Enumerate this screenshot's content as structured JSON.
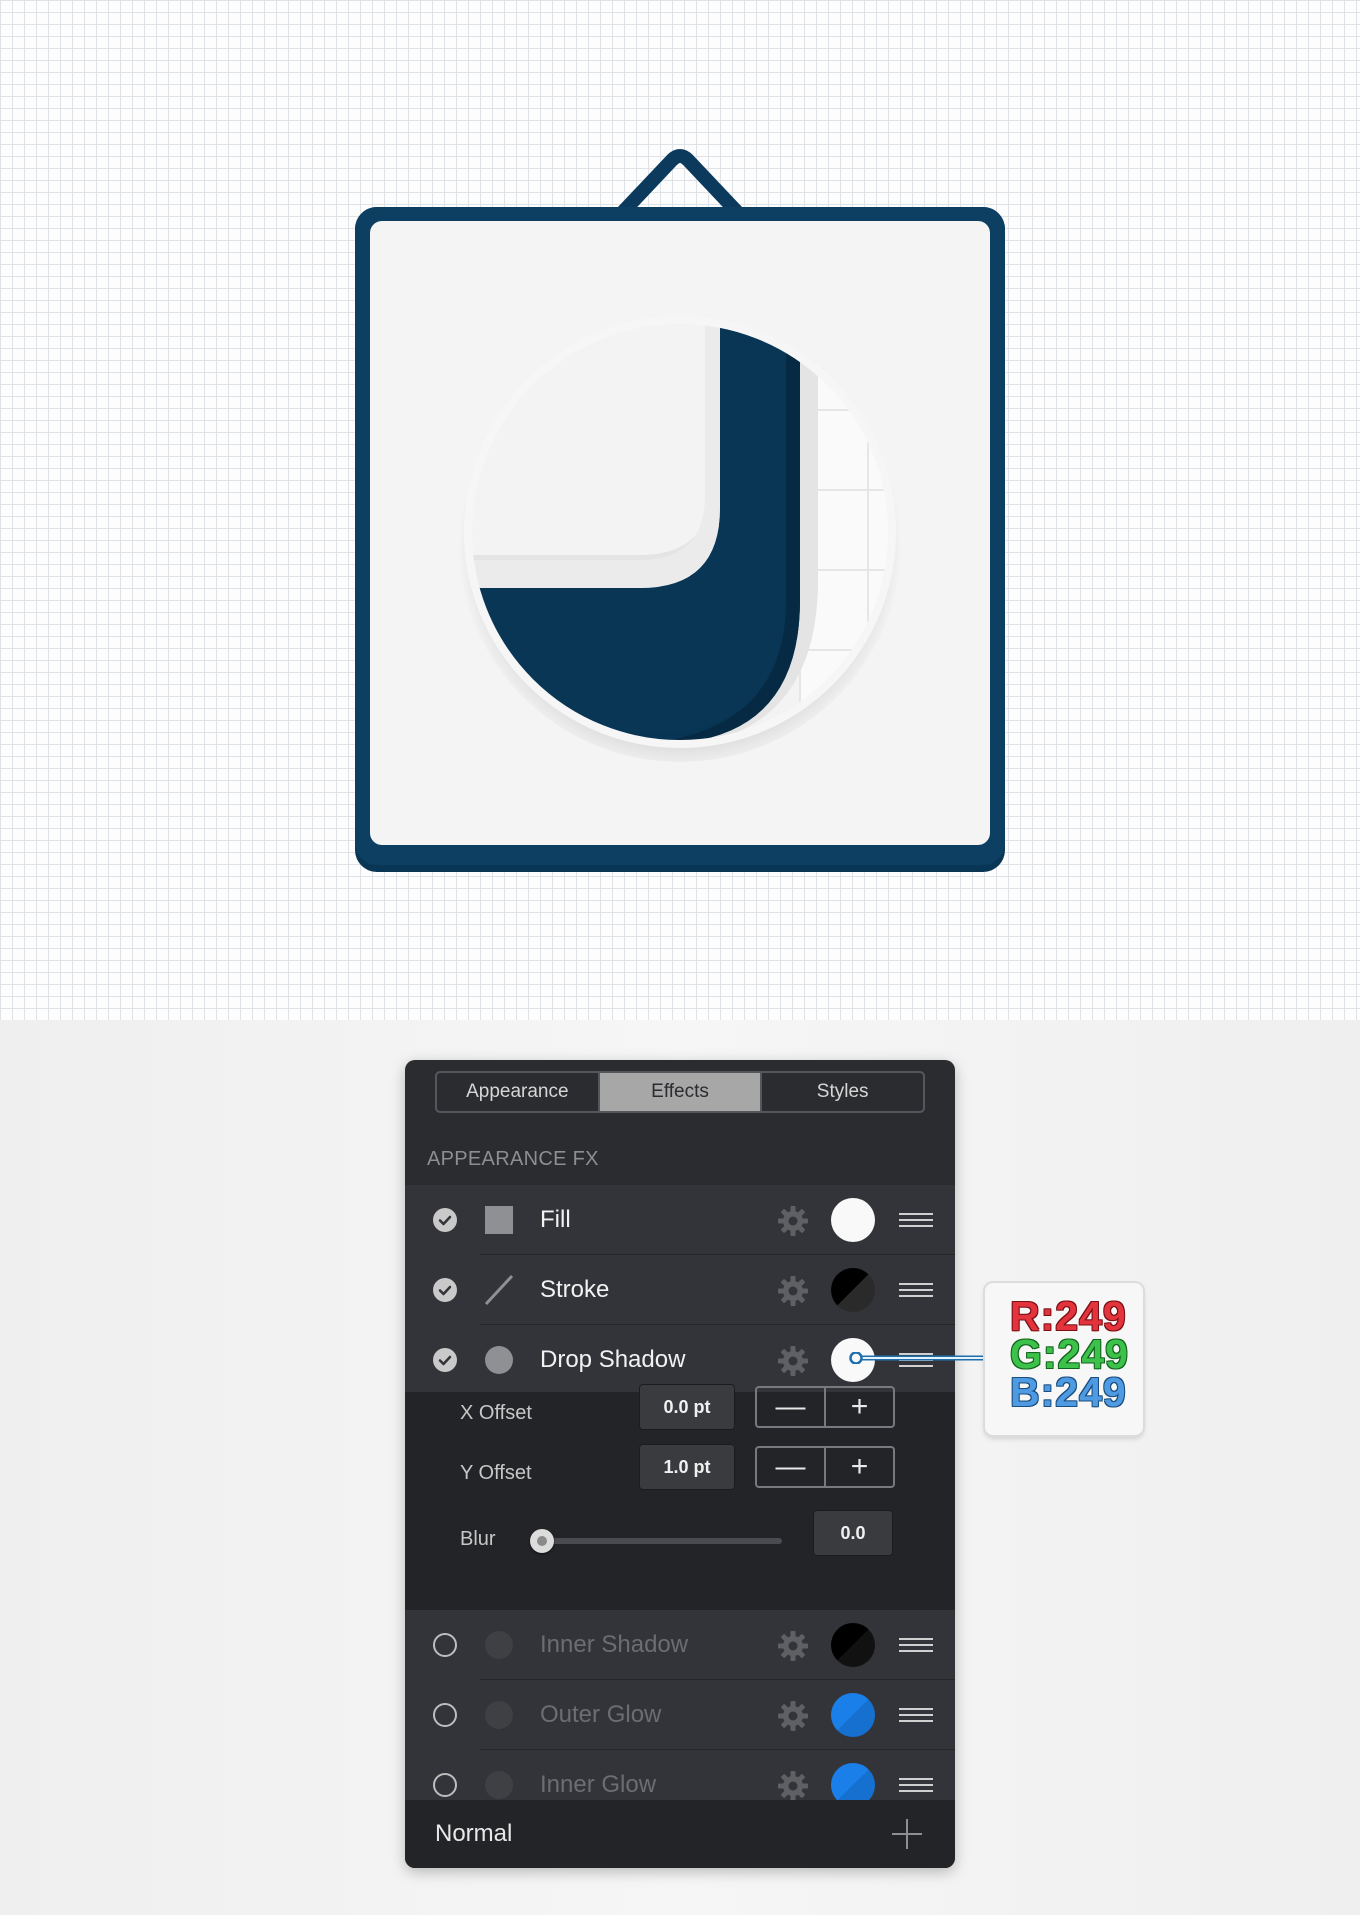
{
  "panel": {
    "tabs": [
      {
        "label": "Appearance",
        "active": false
      },
      {
        "label": "Effects",
        "active": true
      },
      {
        "label": "Styles",
        "active": false
      }
    ],
    "section_title": "APPEARANCE FX",
    "effects": [
      {
        "label": "Fill",
        "enabled": true,
        "icon": "fill-square-icon",
        "swatch": "#f9f9f9"
      },
      {
        "label": "Stroke",
        "enabled": true,
        "icon": "stroke-line-icon",
        "swatch": "#000000"
      },
      {
        "label": "Drop Shadow",
        "enabled": true,
        "icon": "shadow-circle-icon",
        "swatch": "#f9f9f9"
      },
      {
        "label": "Inner Shadow",
        "enabled": false,
        "icon": "shadow-circle-icon",
        "swatch": "#000000"
      },
      {
        "label": "Outer Glow",
        "enabled": false,
        "icon": "shadow-circle-icon",
        "swatch": "#1a7fe8"
      },
      {
        "label": "Inner Glow",
        "enabled": false,
        "icon": "shadow-circle-icon",
        "swatch": "#1a7fe8"
      }
    ],
    "drop_shadow": {
      "x_offset_label": "X Offset",
      "x_offset_value": "0.0 pt",
      "y_offset_label": "Y Offset",
      "y_offset_value": "1.0 pt",
      "blur_label": "Blur",
      "blur_value": "0.0",
      "minus": "—",
      "plus": "+"
    },
    "blend_mode": "Normal"
  },
  "callout": {
    "r": "R:249",
    "g": "G:249",
    "b": "B:249"
  },
  "colors": {
    "frame": "#0b3a5c",
    "board": "#f4f4f4",
    "accent_blue": "#1a7fe8"
  }
}
